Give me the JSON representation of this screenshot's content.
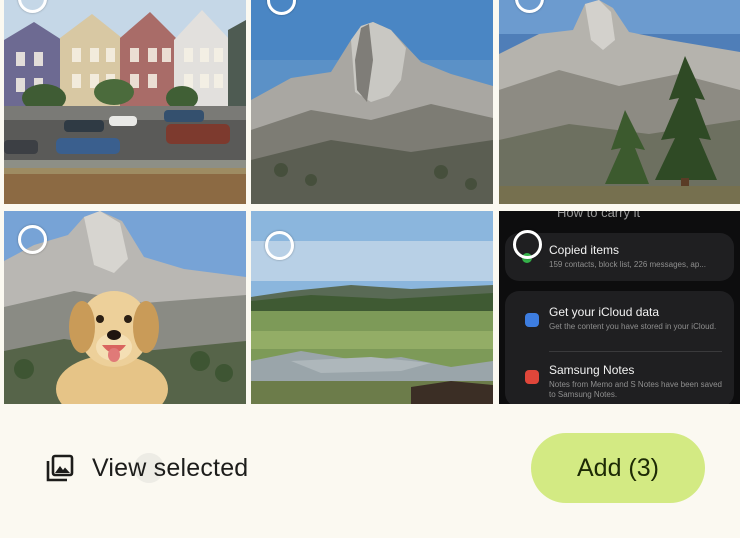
{
  "photo_grid": {
    "tiles": [
      {
        "name": "painted-ladies-houses-photo",
        "selected": false
      },
      {
        "name": "half-dome-photo",
        "selected": false
      },
      {
        "name": "half-dome-with-pine-photo",
        "selected": false
      },
      {
        "name": "golden-retriever-half-dome-photo",
        "selected": false
      },
      {
        "name": "yosemite-meadow-photo",
        "selected": false
      },
      {
        "name": "samsung-settings-screenshot",
        "selected": true
      }
    ],
    "screenshot_tile": {
      "header_text": "How to carry it",
      "items": [
        {
          "title": "Copied items",
          "description": "159 contacts, block list, 226 messages, ap..."
        },
        {
          "title": "Get your iCloud data",
          "description": "Get the content you have stored in your iCloud."
        },
        {
          "title": "Samsung Notes",
          "description": "Notes from Memo and S Notes have been saved to Samsung Notes."
        }
      ]
    }
  },
  "bottom_bar": {
    "view_selected_label": "View selected",
    "view_selected_icon": "photo-library-icon",
    "add_button_label": "Add (3)"
  },
  "colors": {
    "background": "#fbf9f1",
    "add_button": "#d3ea83",
    "text_primary": "#1d1d1b",
    "screenshot_bg": "#0d0d0e",
    "selection_dot": "#35b34a"
  }
}
